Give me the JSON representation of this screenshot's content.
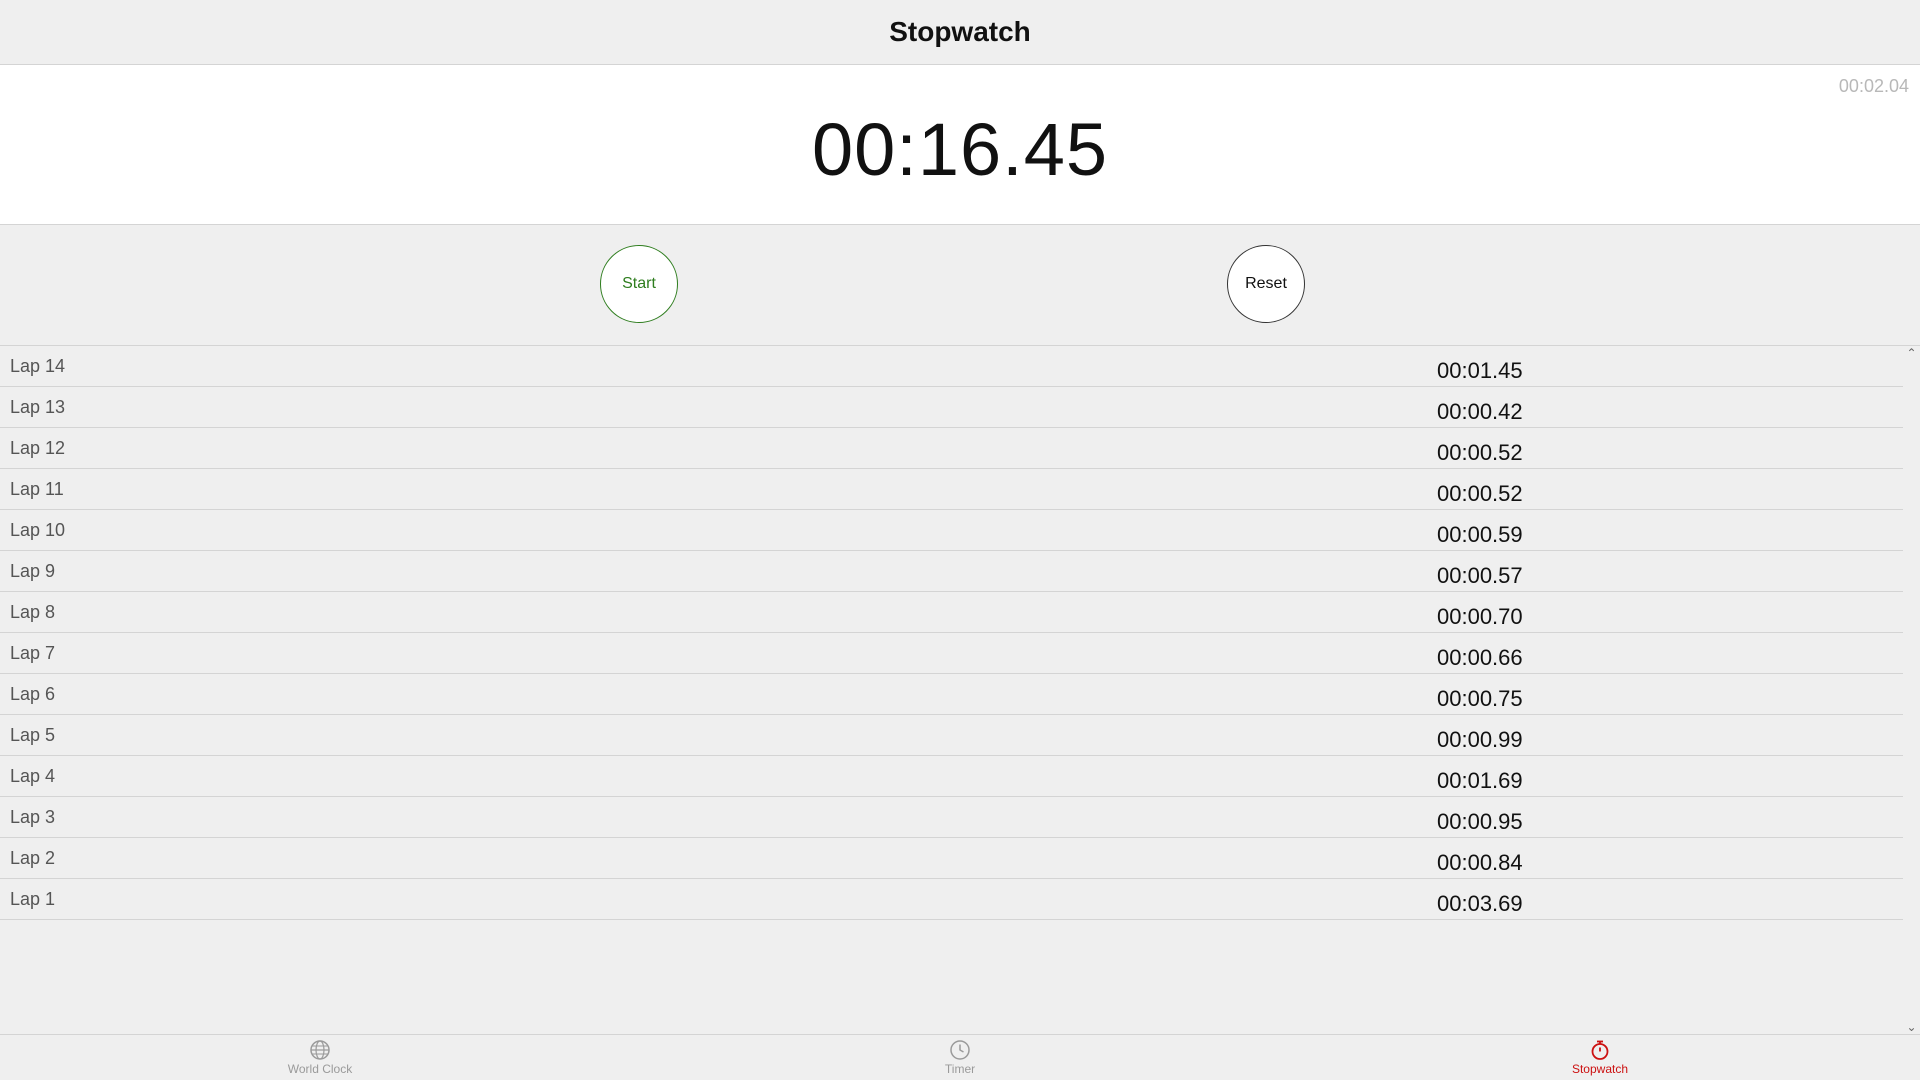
{
  "header": {
    "title": "Stopwatch"
  },
  "display": {
    "main_time": "00:16.45",
    "current_lap_time": "00:02.04"
  },
  "controls": {
    "start_label": "Start",
    "reset_label": "Reset"
  },
  "laps": [
    {
      "name": "Lap 14",
      "time": "00:01.45"
    },
    {
      "name": "Lap 13",
      "time": "00:00.42"
    },
    {
      "name": "Lap 12",
      "time": "00:00.52"
    },
    {
      "name": "Lap 11",
      "time": "00:00.52"
    },
    {
      "name": "Lap 10",
      "time": "00:00.59"
    },
    {
      "name": "Lap 9",
      "time": "00:00.57"
    },
    {
      "name": "Lap 8",
      "time": "00:00.70"
    },
    {
      "name": "Lap 7",
      "time": "00:00.66"
    },
    {
      "name": "Lap 6",
      "time": "00:00.75"
    },
    {
      "name": "Lap 5",
      "time": "00:00.99"
    },
    {
      "name": "Lap 4",
      "time": "00:01.69"
    },
    {
      "name": "Lap 3",
      "time": "00:00.95"
    },
    {
      "name": "Lap 2",
      "time": "00:00.84"
    },
    {
      "name": "Lap 1",
      "time": "00:03.69"
    }
  ],
  "tabs": [
    {
      "label": "World Clock",
      "icon": "globe-icon",
      "active": false
    },
    {
      "label": "Timer",
      "icon": "clock-icon",
      "active": false
    },
    {
      "label": "Stopwatch",
      "icon": "stopwatch-icon",
      "active": true
    }
  ],
  "colors": {
    "start_green": "#2e7d1e",
    "active_tab_red": "#cc1111",
    "inactive_tab_gray": "#9a9a9a"
  }
}
